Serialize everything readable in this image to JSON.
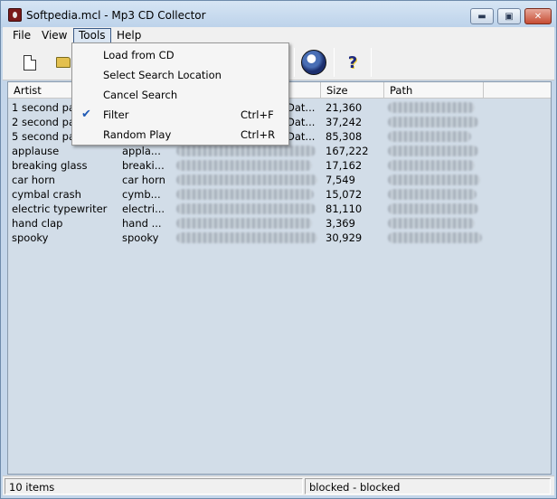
{
  "window": {
    "title": "Softpedia.mcl - Mp3 CD Collector",
    "min_glyph": "▬",
    "max_glyph": "▣",
    "close_glyph": "✕"
  },
  "menubar": {
    "items": [
      "File",
      "View",
      "Tools",
      "Help"
    ],
    "active": "Tools"
  },
  "toolbar": {
    "icons": [
      "new-document-icon",
      "open-folder-icon",
      "globe-icon",
      "help-icon"
    ],
    "help_glyph": "?"
  },
  "listview": {
    "columns": [
      "Artist",
      "Size",
      "Path"
    ],
    "rows": [
      {
        "artist": "1 second pau",
        "title": "",
        "album": "Dat...",
        "size": "21,360"
      },
      {
        "artist": "2 second pau",
        "title": "",
        "album": "Dat...",
        "size": "37,242"
      },
      {
        "artist": "5 second pau",
        "title": "",
        "album": "Dat...",
        "size": "85,308"
      },
      {
        "artist": "applause",
        "title": "appla...",
        "album": "",
        "size": "167,222"
      },
      {
        "artist": "breaking glass",
        "title": "breaki...",
        "album": "",
        "size": "17,162"
      },
      {
        "artist": "car horn",
        "title": "car horn",
        "album": "",
        "size": "7,549"
      },
      {
        "artist": "cymbal crash",
        "title": "cymb...",
        "album": "",
        "size": "15,072"
      },
      {
        "artist": "electric typewriter",
        "title": "electri...",
        "album": "",
        "size": "81,110"
      },
      {
        "artist": "hand clap",
        "title": "hand ...",
        "album": "",
        "size": "3,369"
      },
      {
        "artist": "spooky",
        "title": "spooky",
        "album": "",
        "size": "30,929"
      }
    ]
  },
  "tools_menu": {
    "items": [
      {
        "label": "Load from CD",
        "shortcut": "",
        "checked": false
      },
      {
        "label": "Select Search Location",
        "shortcut": "",
        "checked": false
      },
      {
        "label": "Cancel Search",
        "shortcut": "",
        "checked": false
      },
      {
        "label": "Filter",
        "shortcut": "Ctrl+F",
        "checked": true
      },
      {
        "label": "Random Play",
        "shortcut": "Ctrl+R",
        "checked": false
      }
    ],
    "check_glyph": "✔"
  },
  "statusbar": {
    "count": "10 items",
    "state": "blocked - blocked"
  }
}
